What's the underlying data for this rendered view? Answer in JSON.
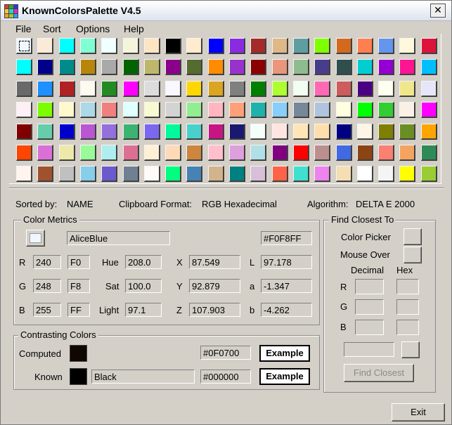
{
  "window": {
    "title": "KnownColorsPalette V4.5",
    "close_glyph": "✕"
  },
  "menu": [
    "File",
    "Sort",
    "Options",
    "Help"
  ],
  "palette": [
    [
      "#F0F8FF",
      "#FAEBD7",
      "#00FFFF",
      "#7FFFD4",
      "#F0FFFF",
      "#F5F5DC",
      "#FFE4C4",
      "#000000",
      "#FFEBCD",
      "#0000FF",
      "#8A2BE2",
      "#A52A2A",
      "#DEB887",
      "#5F9EA0",
      "#7FFF00",
      "#D2691E",
      "#FF7F50",
      "#6495ED",
      "#FFF8DC",
      "#DC143C"
    ],
    [
      "#00FFFF",
      "#00008B",
      "#008B8B",
      "#B8860B",
      "#A9A9A9",
      "#006400",
      "#BDB76B",
      "#8B008B",
      "#556B2F",
      "#FF8C00",
      "#9932CC",
      "#8B0000",
      "#E9967A",
      "#8FBC8F",
      "#483D8B",
      "#2F4F4F",
      "#00CED1",
      "#9400D3",
      "#FF1493",
      "#00BFFF"
    ],
    [
      "#696969",
      "#1E90FF",
      "#B22222",
      "#FFFAF0",
      "#228B22",
      "#FF00FF",
      "#DCDCDC",
      "#F8F8FF",
      "#FFD700",
      "#DAA520",
      "#808080",
      "#008000",
      "#ADFF2F",
      "#F0FFF0",
      "#FF69B4",
      "#CD5C5C",
      "#4B0082",
      "#FFFFF0",
      "#F0E68C",
      "#E6E6FA"
    ],
    [
      "#FFF0F5",
      "#7CFC00",
      "#FFFACD",
      "#ADD8E6",
      "#F08080",
      "#E0FFFF",
      "#FAFAD2",
      "#D3D3D3",
      "#90EE90",
      "#FFB6C1",
      "#FFA07A",
      "#20B2AA",
      "#87CEFA",
      "#778899",
      "#B0C4DE",
      "#FFFFE0",
      "#00FF00",
      "#32CD32",
      "#FAF0E6",
      "#FF00FF"
    ],
    [
      "#800000",
      "#66CDAA",
      "#0000CD",
      "#BA55D3",
      "#9370DB",
      "#3CB371",
      "#7B68EE",
      "#00FA9A",
      "#48D1CC",
      "#C71585",
      "#191970",
      "#F5FFFA",
      "#FFE4E1",
      "#FFE4B5",
      "#FFDEAD",
      "#000080",
      "#FDF5E6",
      "#808000",
      "#6B8E23",
      "#FFA500"
    ],
    [
      "#FF4500",
      "#DA70D6",
      "#EEE8AA",
      "#98FB98",
      "#AFEEEE",
      "#DB7093",
      "#FFEFD5",
      "#FFDAB9",
      "#CD853F",
      "#FFC0CB",
      "#DDA0DD",
      "#B0E0E6",
      "#800080",
      "#FF0000",
      "#BC8F8F",
      "#4169E1",
      "#8B4513",
      "#FA8072",
      "#F4A460",
      "#2E8B57"
    ],
    [
      "#FFF5EE",
      "#A0522D",
      "#C0C0C0",
      "#87CEEB",
      "#6A5ACD",
      "#708090",
      "#FFFAFA",
      "#00FF7F",
      "#4682B4",
      "#D2B48C",
      "#008080",
      "#D8BFD8",
      "#FF6347",
      "#40E0D0",
      "#EE82EE",
      "#F5DEB3",
      "#FFFFFF",
      "#F5F5F5",
      "#FFFF00",
      "#9ACD32"
    ]
  ],
  "status": {
    "sorted_label": "Sorted by:",
    "sorted_value": "NAME",
    "clipboard_label": "Clipboard Format:",
    "clipboard_value": "RGB Hexadecimal",
    "algorithm_label": "Algorithm:",
    "algorithm_value": "DELTA E 2000"
  },
  "metrics": {
    "title": "Color Metrics",
    "swatch_color": "#F0F8FF",
    "name": "AliceBlue",
    "hex": "#F0F8FF",
    "r_label": "R",
    "r": "240",
    "r_hex": "F0",
    "g_label": "G",
    "g": "248",
    "g_hex": "F8",
    "b_label": "B",
    "b": "255",
    "b_hex": "FF",
    "hue_label": "Hue",
    "hue": "208.0",
    "sat_label": "Sat",
    "sat": "100.0",
    "light_label": "Light",
    "light": "97.1",
    "x_label": "X",
    "x": "87.549",
    "y_label": "Y",
    "y": "92.879",
    "z_label": "Z",
    "z": "107.903",
    "l_label": "L",
    "l": "97.178",
    "a_label": "a",
    "a": "-1.347",
    "bb_label": "b",
    "bb": "-4.262"
  },
  "contrasting": {
    "title": "Contrasting Colors",
    "computed_label": "Computed",
    "computed_color": "#0F0700",
    "computed_hex": "#0F0700",
    "known_label": "Known",
    "known_color": "#000000",
    "known_name": "Black",
    "known_hex": "#000000",
    "example_label": "Example"
  },
  "find_closest": {
    "title": "Find Closest To",
    "color_picker_label": "Color Picker",
    "mouse_over_label": "Mouse Over",
    "decimal_label": "Decimal",
    "hex_label": "Hex",
    "r_label": "R",
    "g_label": "G",
    "b_label": "B",
    "button_label": "Find Closest"
  },
  "exit_label": "Exit"
}
